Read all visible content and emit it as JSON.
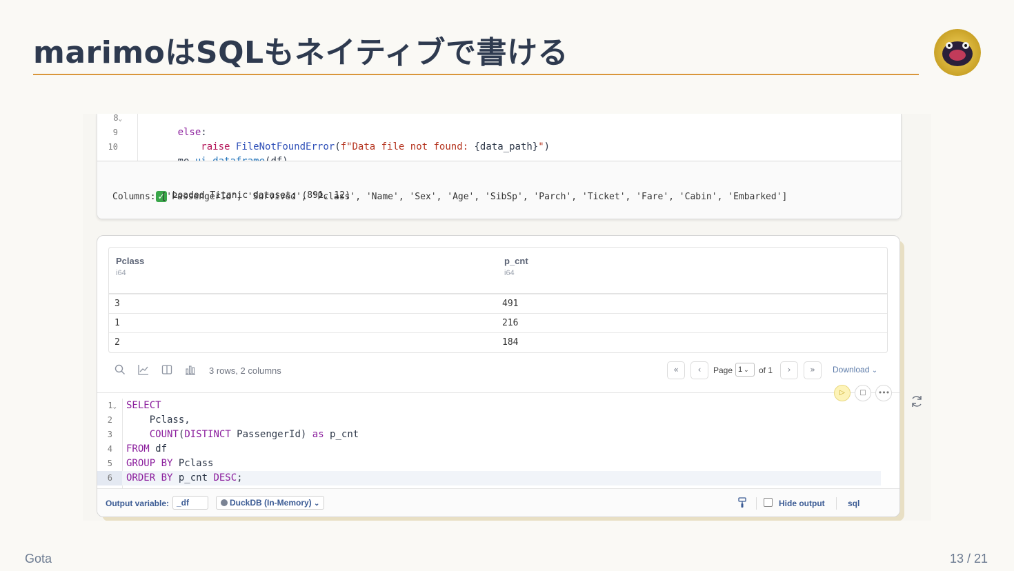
{
  "slide": {
    "title": "marimoはSQLもネイティブで書ける",
    "author": "Gota",
    "page": "13 / 21"
  },
  "top_cell": {
    "lines": [
      {
        "num": "8",
        "fold": "⌄"
      },
      {
        "num": "9"
      },
      {
        "num": "10"
      }
    ],
    "output": {
      "line1": "Loaded Titanic dataset: (891, 12)",
      "line2": "Columns: ['PassengerId', 'Survived', 'Pclass', 'Name', 'Sex', 'Age', 'SibSp', 'Parch', 'Ticket', 'Fare', 'Cabin', 'Embarked']"
    },
    "code": {
      "l8_kw": "else",
      "l8_rest": ":",
      "l9_indent": "    ",
      "l9_kw": "raise",
      "l9_fn": "FileNotFoundError",
      "l9_open": "(",
      "l9_str": "f\"Data file not found: ",
      "l9_var": "{data_path}",
      "l9_str2": "\"",
      "l9_close": ")",
      "l10_a": "mo",
      "l10_b": ".ui.dataframe",
      "l10_c": "(df)"
    }
  },
  "result_table": {
    "columns": [
      {
        "name": "Pclass",
        "type": "i64"
      },
      {
        "name": "p_cnt",
        "type": "i64"
      }
    ],
    "rows": [
      [
        "3",
        "491"
      ],
      [
        "1",
        "216"
      ],
      [
        "2",
        "184"
      ]
    ],
    "summary": "3 rows, 2 columns",
    "pagination": {
      "page_label": "Page",
      "page_value": "1",
      "of_label": "of 1"
    },
    "download_label": "Download"
  },
  "sql_cell": {
    "line_numbers": [
      "1",
      "2",
      "3",
      "4",
      "5",
      "6"
    ],
    "code": {
      "l1": "SELECT",
      "l2": "    Pclass,",
      "l3_indent": "    ",
      "l3_fn": "COUNT",
      "l3_open": "(",
      "l3_kw": "DISTINCT",
      "l3_rest": " PassengerId) ",
      "l3_as": "as",
      "l3_alias": " p_cnt",
      "l4_kw": "FROM",
      "l4_rest": " df",
      "l5_kw": "GROUP BY",
      "l5_rest": " Pclass",
      "l6_kw": "ORDER BY",
      "l6_mid": " p_cnt ",
      "l6_kw2": "DESC",
      "l6_rest": ";"
    },
    "footer": {
      "output_variable_label": "Output variable:",
      "output_variable_value": "_df",
      "engine": "DuckDB (In-Memory)",
      "hide_output_label": "Hide output",
      "language": "sql"
    }
  },
  "icons": {
    "search": "search-icon",
    "chart": "chart-icon",
    "columns": "columns-icon",
    "stats": "stats-icon",
    "first": "first-page-icon",
    "prev": "prev-page-icon",
    "next": "next-page-icon",
    "last": "last-page-icon",
    "run": "run-icon",
    "stop": "stop-icon",
    "more": "more-icon",
    "refresh": "refresh-icon",
    "brush": "brush-icon"
  },
  "colors": {
    "accent_rule": "#d9963a",
    "title": "#2e3a4f",
    "run_highlight": "#fdf3b8"
  }
}
